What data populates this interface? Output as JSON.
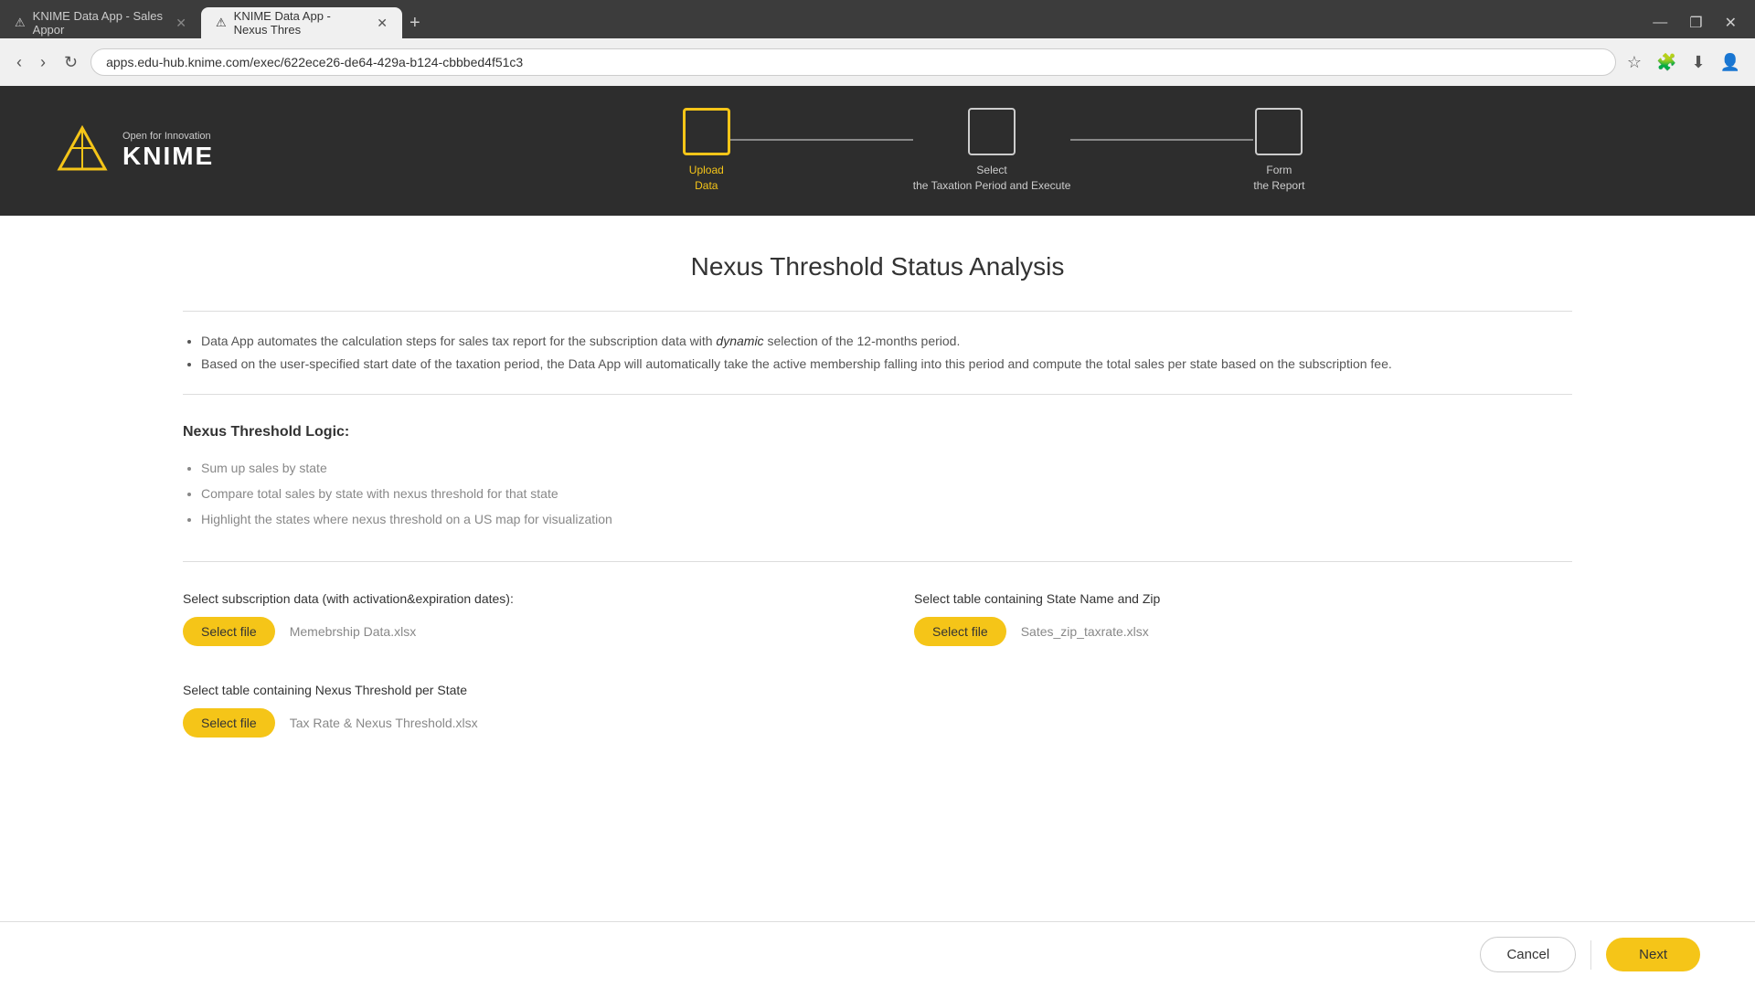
{
  "browser": {
    "tabs": [
      {
        "id": "tab1",
        "title": "KNIME Data App - Sales Appor",
        "active": false,
        "favicon": "⚠"
      },
      {
        "id": "tab2",
        "title": "KNIME Data App - Nexus Thres",
        "active": true,
        "favicon": "⚠"
      }
    ],
    "new_tab_label": "+",
    "url": "apps.edu-hub.knime.com/exec/622ece26-de64-429a-b124-cbbbed4f51c3",
    "window_controls": {
      "minimize": "—",
      "maximize": "❐",
      "close": "✕"
    }
  },
  "header": {
    "logo": {
      "tagline": "Open for Innovation",
      "brand": "KNIME"
    },
    "steps": [
      {
        "id": "upload",
        "label": "Upload\nData",
        "active": true
      },
      {
        "id": "select",
        "label": "Select\nthe Taxation Period and Execute",
        "active": false
      },
      {
        "id": "form",
        "label": "Form\nthe Report",
        "active": false
      }
    ]
  },
  "page": {
    "title": "Nexus Threshold Status Analysis",
    "description_items": [
      "Data App automates the calculation steps for sales tax report for the subscription data with dynamic selection of the 12-months period.",
      "Based on the user-specified start date of the taxation period, the Data App will automatically take the active membership falling into this period and compute the total sales per state based on the subscription fee."
    ],
    "nexus_logic": {
      "title": "Nexus Threshold Logic:",
      "items": [
        "Sum up sales by state",
        "Compare total sales by state with nexus threshold for that state",
        "Highlight the states where nexus threshold on a US map for visualization"
      ]
    },
    "file_sections": {
      "subscription_label": "Select subscription data (with activation&expiration dates):",
      "subscription_btn": "Select file",
      "subscription_file": "Memebrship Data.xlsx",
      "state_label": "Select table containing State Name and Zip",
      "state_btn": "Select file",
      "state_file": "Sates_zip_taxrate.xlsx",
      "nexus_label": "Select table containing Nexus Threshold per State",
      "nexus_btn": "Select file",
      "nexus_file": "Tax Rate & Nexus Threshold.xlsx"
    },
    "buttons": {
      "cancel": "Cancel",
      "next": "Next"
    }
  }
}
